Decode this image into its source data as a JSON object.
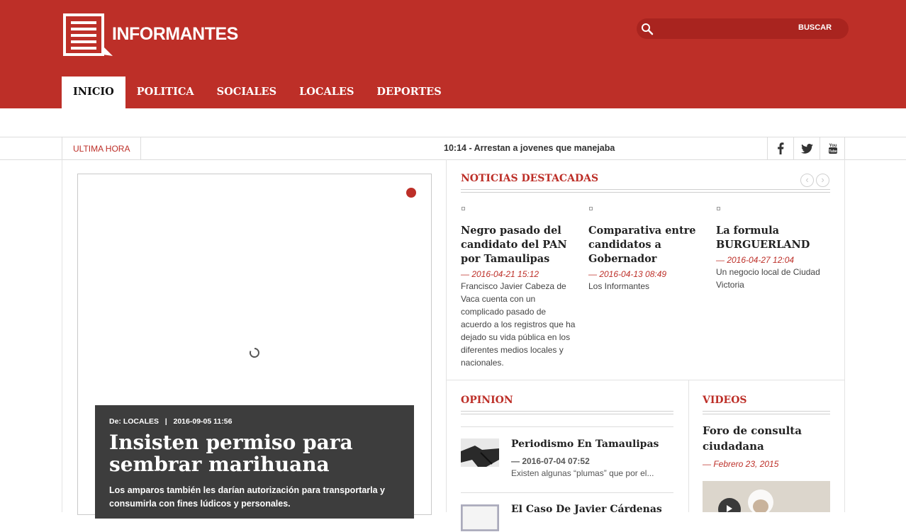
{
  "header": {
    "logo_text": "INFORMANTES",
    "search": {
      "placeholder": "",
      "button_label": "BUSCAR"
    },
    "nav": [
      {
        "label": "INICIO",
        "active": true
      },
      {
        "label": "POLITICA",
        "active": false
      },
      {
        "label": "SOCIALES",
        "active": false
      },
      {
        "label": "LOCALES",
        "active": false
      },
      {
        "label": "DEPORTES",
        "active": false
      }
    ]
  },
  "ticker": {
    "label": "ULTIMA HORA",
    "text": "10:14 - Arrestan a jovenes que manejaba",
    "social": [
      "facebook-icon",
      "twitter-icon",
      "youtube-icon"
    ]
  },
  "slider": {
    "meta_section": "De: LOCALES",
    "meta_separator": "|",
    "meta_date": "2016-09-05 11:56",
    "title": "Insisten permiso para sembrar marihuana",
    "description": "Los amparos también les darían autorización para transportarla y consumirla con fines lúdicos y personales."
  },
  "featured": {
    "title": "NOTICIAS DESTACADAS",
    "items": [
      {
        "title": "Negro pasado del candidato del PAN por Tamaulipas",
        "date": "— 2016-04-21 15:12",
        "desc": "Francisco  Javier Cabeza de Vaca cuenta con un complicado pasado de acuerdo a los registros que ha dejado su vida pública en los diferentes medios locales y nacionales."
      },
      {
        "title": "Comparativa entre candidatos a Gobernador",
        "date": "— 2016-04-13 08:49",
        "desc": "Los Informantes"
      },
      {
        "title": "La formula BURGUERLAND",
        "date": "— 2016-04-27 12:04",
        "desc": "Un negocio local de Ciudad Victoria"
      }
    ]
  },
  "opinion": {
    "title": "OPINION",
    "items": [
      {
        "title": "Periodismo En Tamaulipas",
        "date": "— 2016-07-04 07:52",
        "desc": "Existen algunas “plumas” que por el..."
      },
      {
        "title": "El Caso De Javier Cárdenas",
        "date": "",
        "desc": ""
      }
    ]
  },
  "videos": {
    "title": "VIDEOS",
    "item": {
      "title": "Foro de consulta ciudadana",
      "date": "— Febrero 23, 2015"
    }
  },
  "colors": {
    "brand": "#bd2f28",
    "caption_bg": "#3d3d3d"
  }
}
